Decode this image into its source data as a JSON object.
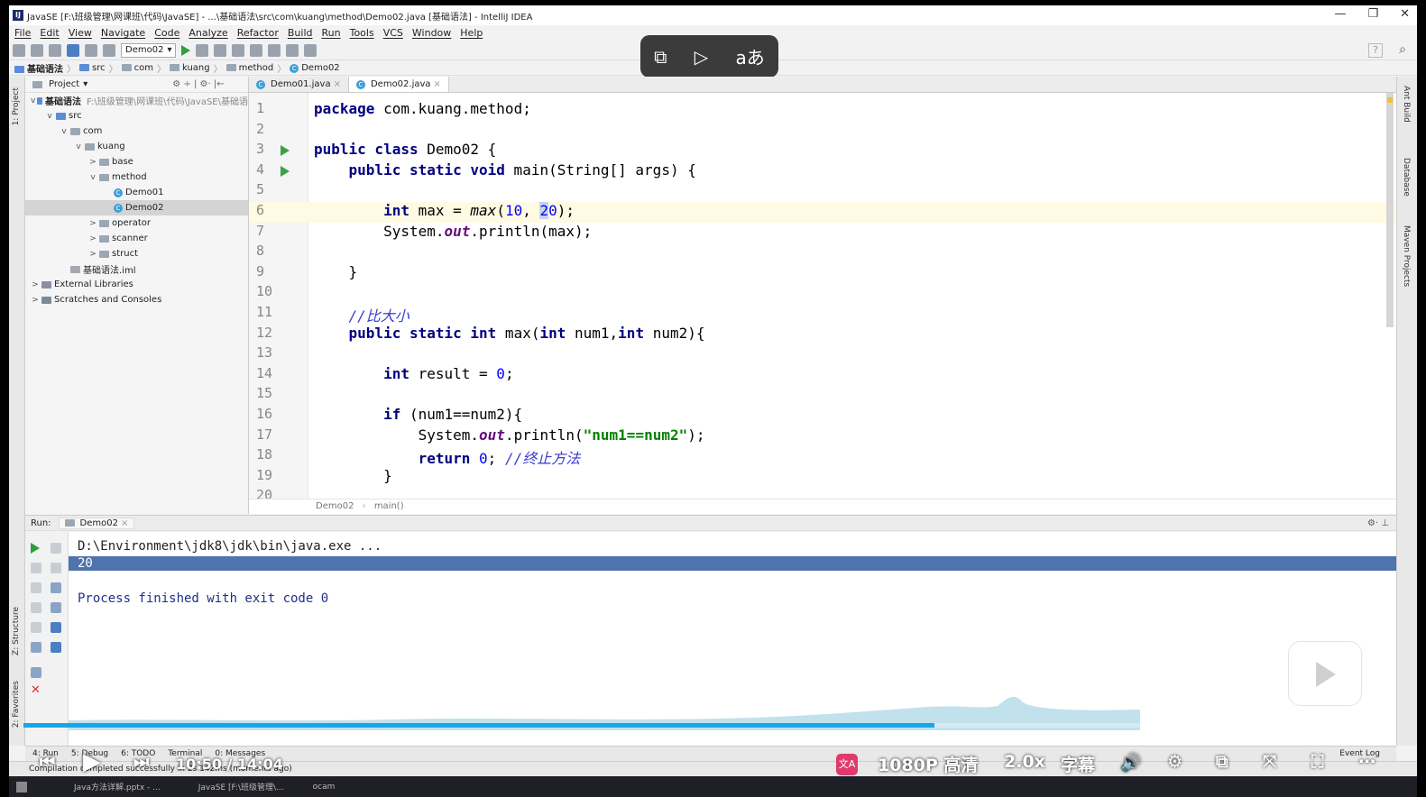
{
  "window": {
    "title": "JavaSE [F:\\班级管理\\网课班\\代码\\JavaSE] - ...\\基础语法\\src\\com\\kuang\\method\\Demo02.java [基础语法] - IntelliJ IDEA",
    "icon_text": "IJ",
    "minimize": "—",
    "restore": "❐",
    "close": "✕"
  },
  "menu": [
    "File",
    "Edit",
    "View",
    "Navigate",
    "Code",
    "Analyze",
    "Refactor",
    "Build",
    "Run",
    "Tools",
    "VCS",
    "Window",
    "Help"
  ],
  "toolbar": {
    "run_config": "Demo02",
    "run_config_arrow": "▾",
    "help_glyph": "?",
    "search_glyph": "⌕"
  },
  "overlay_icons": [
    "⧉",
    "▷",
    "aあ"
  ],
  "breadcrumb": [
    "基础语法",
    "src",
    "com",
    "kuang",
    "method",
    "Demo02"
  ],
  "left_strip": {
    "project": "1: Project",
    "structure": "Z: Structure",
    "favorites": "2: Favorites"
  },
  "project_panel": {
    "header": "Project",
    "header_arrow": "▾",
    "header_icons": "⚙ ÷ | ⚙· |←",
    "tree": [
      {
        "label": "基础语法",
        "extra": "F:\\班级管理\\网课班\\代码\\JavaSE\\基础语",
        "indent": 0,
        "chev": "v",
        "icon": "folder-blue",
        "bold": true
      },
      {
        "label": "src",
        "indent": 1,
        "chev": "v",
        "icon": "folder-blue"
      },
      {
        "label": "com",
        "indent": 2,
        "chev": "v",
        "icon": "folder"
      },
      {
        "label": "kuang",
        "indent": 3,
        "chev": "v",
        "icon": "folder"
      },
      {
        "label": "base",
        "indent": 4,
        "chev": ">",
        "icon": "folder"
      },
      {
        "label": "method",
        "indent": 4,
        "chev": "v",
        "icon": "folder"
      },
      {
        "label": "Demo01",
        "indent": 5,
        "chev": "",
        "icon": "class"
      },
      {
        "label": "Demo02",
        "indent": 5,
        "chev": "",
        "icon": "class",
        "selected": true
      },
      {
        "label": "operator",
        "indent": 4,
        "chev": ">",
        "icon": "folder"
      },
      {
        "label": "scanner",
        "indent": 4,
        "chev": ">",
        "icon": "folder"
      },
      {
        "label": "struct",
        "indent": 4,
        "chev": ">",
        "icon": "folder"
      },
      {
        "label": "基础语法.iml",
        "indent": 2,
        "chev": "",
        "icon": "file"
      },
      {
        "label": "External Libraries",
        "indent": 0,
        "chev": ">",
        "icon": "lib"
      },
      {
        "label": "Scratches and Consoles",
        "indent": 0,
        "chev": ">",
        "icon": "scratch"
      }
    ]
  },
  "editor_tabs": [
    {
      "label": "Demo01.java",
      "close": "×",
      "active": false
    },
    {
      "label": "Demo02.java",
      "close": "×",
      "active": true
    }
  ],
  "code_lines": [
    {
      "n": "1",
      "html": "<span class=\"kw\">package</span> com.kuang.method;"
    },
    {
      "n": "2",
      "html": ""
    },
    {
      "n": "3",
      "html": "<span class=\"kw\">public class</span> Demo02 {",
      "run": true
    },
    {
      "n": "4",
      "html": "    <span class=\"kw\">public static void</span> main(String[] args) {",
      "run": true
    },
    {
      "n": "5",
      "html": ""
    },
    {
      "n": "6",
      "html": "        <span class=\"kw\">int</span> max = <span class=\"it\">max</span>(<span class=\"num\">10</span>, <span class=\"num caret\">2</span><span class=\"num\">0</span>);",
      "current": true
    },
    {
      "n": "7",
      "html": "        System.<span class=\"fld\">out</span>.println(max);"
    },
    {
      "n": "8",
      "html": ""
    },
    {
      "n": "9",
      "html": "    }"
    },
    {
      "n": "10",
      "html": ""
    },
    {
      "n": "11",
      "html": "    <span class=\"cmt\">//比大小</span>"
    },
    {
      "n": "12",
      "html": "    <span class=\"kw\">public static int</span> max(<span class=\"kw\">int</span> num1,<span class=\"kw\">int</span> num2){"
    },
    {
      "n": "13",
      "html": ""
    },
    {
      "n": "14",
      "html": "        <span class=\"kw\">int</span> result = <span class=\"num\">0</span>;"
    },
    {
      "n": "15",
      "html": ""
    },
    {
      "n": "16",
      "html": "        <span class=\"kw\">if</span> (num1==num2){"
    },
    {
      "n": "17",
      "html": "            System.<span class=\"fld\">out</span>.println(<span class=\"str\">\"num1==num2\"</span>);"
    },
    {
      "n": "18",
      "html": "            <span class=\"kw\">return</span> <span class=\"num\">0</span>; <span class=\"cmt\">//终止方法</span>"
    },
    {
      "n": "19",
      "html": "        }"
    },
    {
      "n": "20",
      "html": ""
    }
  ],
  "editor_footer": [
    "Demo02",
    "main()"
  ],
  "right_strip": {
    "ant": "Ant Build",
    "database": "Database",
    "maven": "Maven Projects"
  },
  "run_panel": {
    "label": "Run:",
    "tab": "Demo02",
    "tab_close": "×",
    "settings_glyph": "⚙·  ⊥",
    "console": [
      {
        "text": "D:\\Environment\\jdk8\\jdk\\bin\\java.exe ...",
        "style": ""
      },
      {
        "text": "20",
        "style": "sel"
      },
      {
        "text": "",
        "style": ""
      },
      {
        "text": "Process finished with exit code 0",
        "style": "blue"
      }
    ]
  },
  "tool_tabs": [
    "4: Run",
    "5: Debug",
    "6: TODO",
    "Terminal",
    "0: Messages",
    "Event Log"
  ],
  "status": "Compilation completed successfully in 2s 142ms (moments ago)",
  "taskbar": [
    "Java方法详解.pptx - ...",
    "JavaSE [F:\\班级管理\\...",
    "ocam"
  ],
  "player": {
    "time": "10:50 / 14:04",
    "quality": "1080P 高清",
    "speed": "2.0x",
    "subtitle": "字幕",
    "progress_fraction": 0.772,
    "accent": "#19a6e8",
    "badge": "🅰"
  }
}
